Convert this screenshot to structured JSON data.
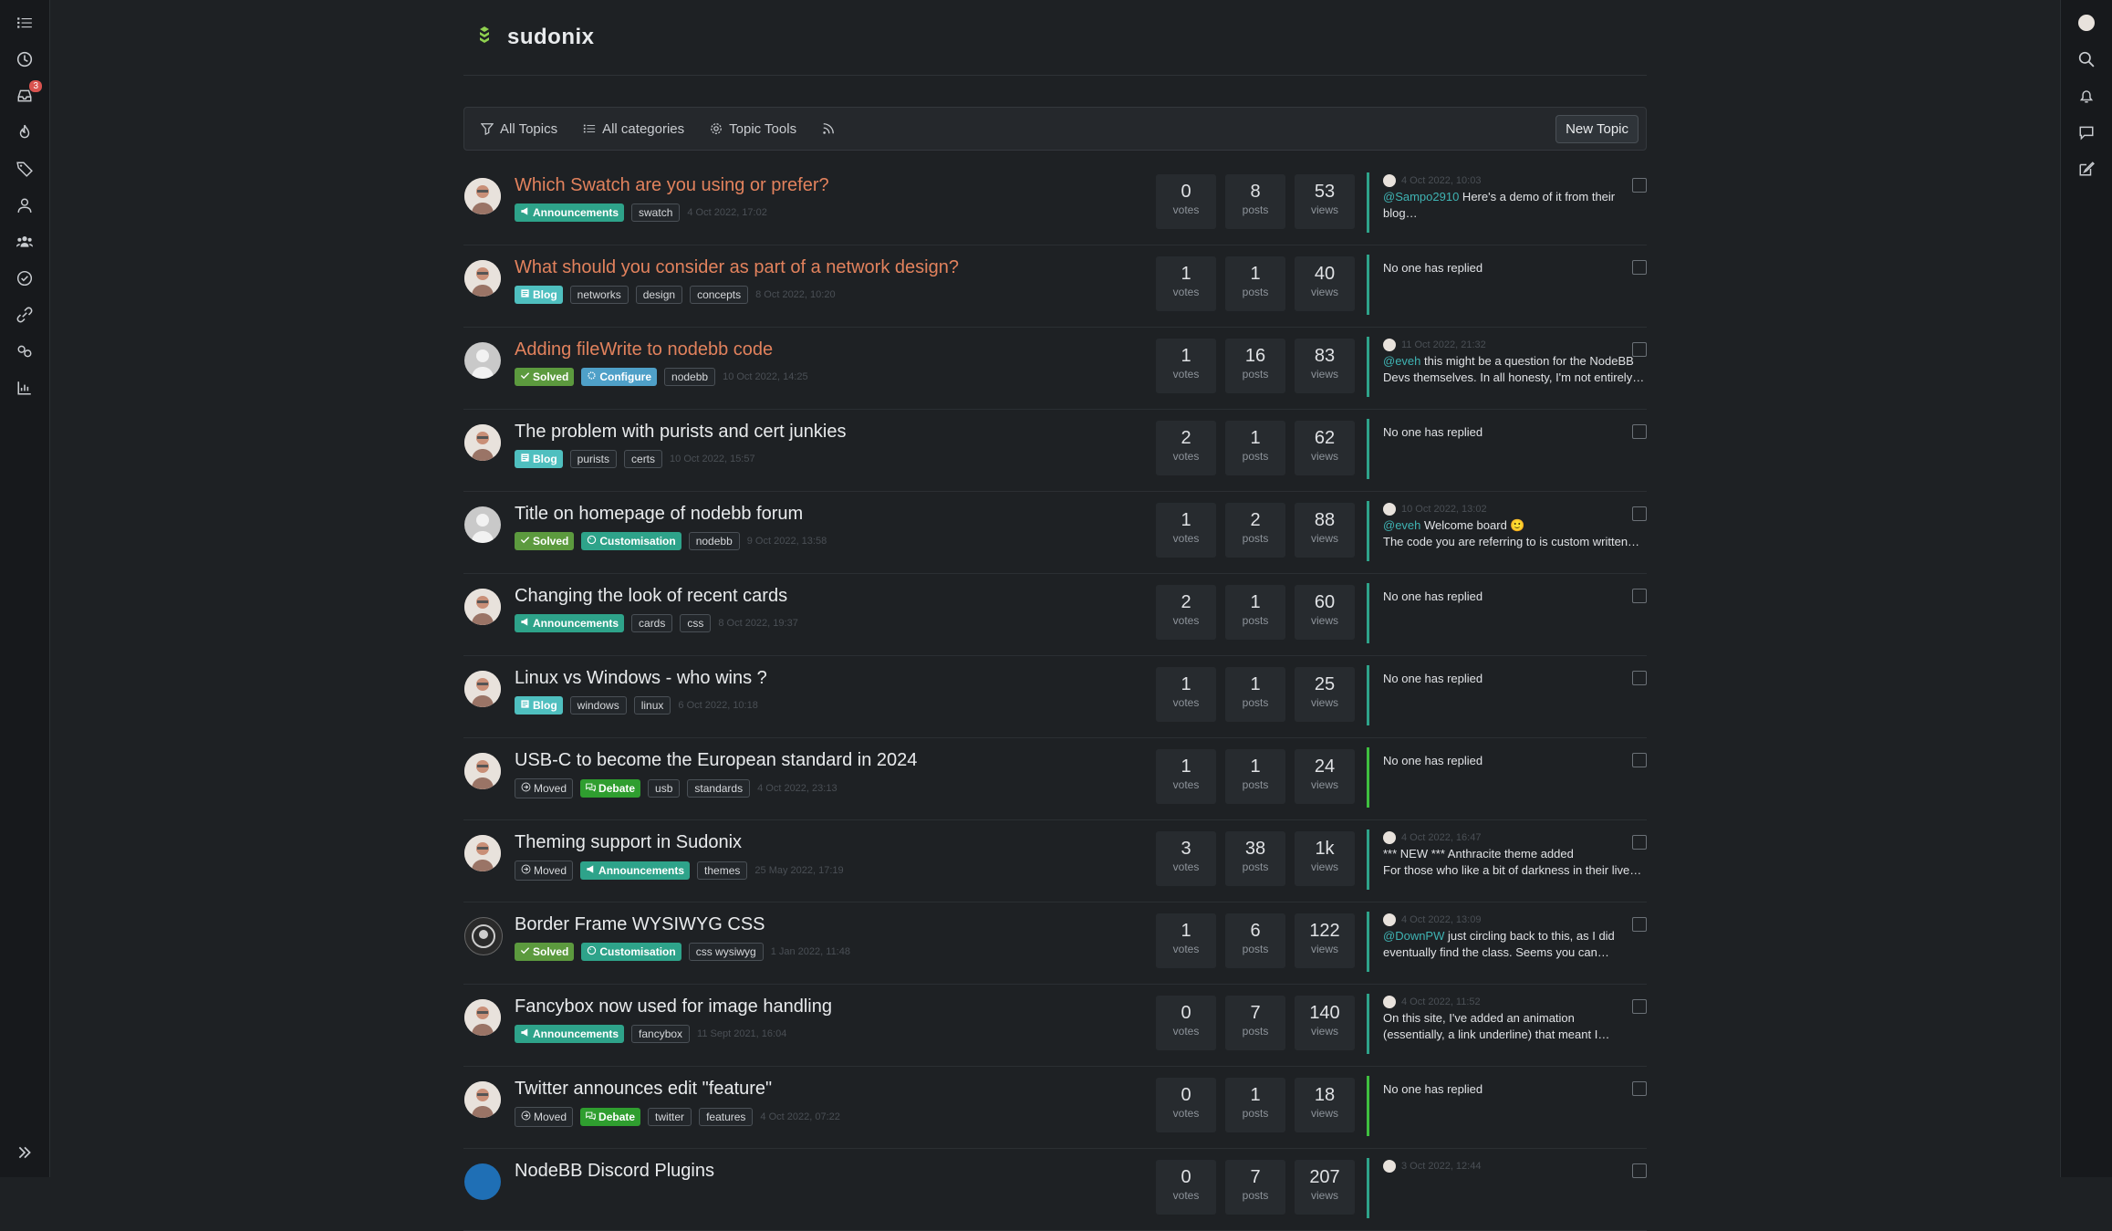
{
  "brand": {
    "name": "sudonix"
  },
  "nav": {
    "inbox_badge": "3"
  },
  "toolbar": {
    "all_topics": "All Topics",
    "all_categories": "All categories",
    "topic_tools": "Topic Tools",
    "new_topic": "New Topic"
  },
  "labels": {
    "votes": "votes",
    "posts": "posts",
    "views": "views"
  },
  "colors": {
    "announcements": "#2ea38a",
    "blog": "#4fbfbf",
    "solved": "#5c9a3e",
    "configure": "#4fa0c8",
    "customisation": "#2ea38a",
    "debate": "#2f9e2f",
    "moved": "#23272b",
    "hot_title": "#e2825d"
  },
  "topics": [
    {
      "title": "Which Swatch are you using or prefer?",
      "hot": true,
      "avatar": "user",
      "pills": [
        {
          "text": "Announcements",
          "kind": "announcements",
          "icon": "megaphone-icon"
        }
      ],
      "tags": [
        "swatch"
      ],
      "time": "4 Oct 2022, 17:02",
      "votes": "0",
      "posts": "8",
      "views": "53",
      "last": {
        "time": "4 Oct 2022, 10:03",
        "mention": "@Sampo2910",
        "line1": " Here's a demo of it from their",
        "line2": "blog…"
      },
      "bar": "teal"
    },
    {
      "title": "What should you consider as part of a network design?",
      "hot": true,
      "avatar": "user",
      "pills": [
        {
          "text": "Blog",
          "kind": "blog",
          "icon": "blog-icon"
        }
      ],
      "tags": [
        "networks",
        "design",
        "concepts"
      ],
      "time": "8 Oct 2022, 10:20",
      "votes": "1",
      "posts": "1",
      "views": "40",
      "noreply": "No one has replied",
      "bar": "teal"
    },
    {
      "title": "Adding fileWrite to nodebb code",
      "hot": true,
      "avatar": "grey",
      "pills": [
        {
          "text": "Solved",
          "kind": "solved",
          "icon": "check-icon"
        },
        {
          "text": "Configure",
          "kind": "configure",
          "icon": "cog-icon"
        }
      ],
      "tags": [
        "nodebb"
      ],
      "time": "10 Oct 2022, 14:25",
      "votes": "1",
      "posts": "16",
      "views": "83",
      "last": {
        "time": "11 Oct 2022, 21:32",
        "mention": "@eveh",
        "line1": " this might be a question for the NodeBB",
        "line2": "Devs themselves. In all honesty, I'm not entirely…"
      },
      "bar": "teal"
    },
    {
      "title": "The problem with purists and cert junkies",
      "hot": false,
      "avatar": "user",
      "pills": [
        {
          "text": "Blog",
          "kind": "blog",
          "icon": "blog-icon"
        }
      ],
      "tags": [
        "purists",
        "certs"
      ],
      "time": "10 Oct 2022, 15:57",
      "votes": "2",
      "posts": "1",
      "views": "62",
      "noreply": "No one has replied",
      "bar": "teal"
    },
    {
      "title": "Title on homepage of nodebb forum",
      "hot": false,
      "avatar": "grey",
      "pills": [
        {
          "text": "Solved",
          "kind": "solved",
          "icon": "check-icon"
        },
        {
          "text": "Customisation",
          "kind": "customisation",
          "icon": "brush-icon"
        }
      ],
      "tags": [
        "nodebb"
      ],
      "time": "9 Oct 2022, 13:58",
      "votes": "1",
      "posts": "2",
      "views": "88",
      "last": {
        "time": "10 Oct 2022, 13:02",
        "mention": "@eveh",
        "line1": " Welcome board 🙂",
        "line2": "The code you are referring to is custom written…"
      },
      "bar": "teal"
    },
    {
      "title": "Changing the look of recent cards",
      "hot": false,
      "avatar": "user",
      "pills": [
        {
          "text": "Announcements",
          "kind": "announcements",
          "icon": "megaphone-icon"
        }
      ],
      "tags": [
        "cards",
        "css"
      ],
      "time": "8 Oct 2022, 19:37",
      "votes": "2",
      "posts": "1",
      "views": "60",
      "noreply": "No one has replied",
      "bar": "teal"
    },
    {
      "title": "Linux vs Windows - who wins ?",
      "hot": false,
      "avatar": "user",
      "pills": [
        {
          "text": "Blog",
          "kind": "blog",
          "icon": "blog-icon"
        }
      ],
      "tags": [
        "windows",
        "linux"
      ],
      "time": "6 Oct 2022, 10:18",
      "votes": "1",
      "posts": "1",
      "views": "25",
      "noreply": "No one has replied",
      "bar": "teal"
    },
    {
      "title": "USB-C to become the European standard in 2024",
      "hot": false,
      "avatar": "user",
      "pills": [
        {
          "text": "Moved",
          "kind": "moved",
          "icon": "moved-icon"
        },
        {
          "text": "Debate",
          "kind": "debate",
          "icon": "comments-icon"
        }
      ],
      "tags": [
        "usb",
        "standards"
      ],
      "time": "4 Oct 2022, 23:13",
      "votes": "1",
      "posts": "1",
      "views": "24",
      "noreply": "No one has replied",
      "bar": "green"
    },
    {
      "title": "Theming support in Sudonix",
      "hot": false,
      "avatar": "user",
      "pills": [
        {
          "text": "Moved",
          "kind": "moved",
          "icon": "moved-icon"
        },
        {
          "text": "Announcements",
          "kind": "announcements",
          "icon": "megaphone-icon"
        }
      ],
      "tags": [
        "themes"
      ],
      "time": "25 May 2022, 17:19",
      "votes": "3",
      "posts": "38",
      "views": "1k",
      "last": {
        "time": "4 Oct 2022, 16:47",
        "mention": "",
        "line1": "*** NEW *** Anthracite theme added",
        "line2": "For those who like a bit of darkness in their live…"
      },
      "bar": "teal"
    },
    {
      "title": "Border Frame WYSIWYG CSS",
      "hot": false,
      "avatar": "dark",
      "pills": [
        {
          "text": "Solved",
          "kind": "solved",
          "icon": "check-icon"
        },
        {
          "text": "Customisation",
          "kind": "customisation",
          "icon": "brush-icon"
        }
      ],
      "tags": [
        "css wysiwyg"
      ],
      "time": "1 Jan 2022, 11:48",
      "votes": "1",
      "posts": "6",
      "views": "122",
      "last": {
        "time": "4 Oct 2022, 13:09",
        "mention": "@DownPW",
        "line1": " just circling back to this, as I did",
        "line2": "eventually find the class. Seems you can…"
      },
      "bar": "teal"
    },
    {
      "title": "Fancybox now used for image handling",
      "hot": false,
      "avatar": "user",
      "pills": [
        {
          "text": "Announcements",
          "kind": "announcements",
          "icon": "megaphone-icon"
        }
      ],
      "tags": [
        "fancybox"
      ],
      "time": "11 Sept 2021, 16:04",
      "votes": "0",
      "posts": "7",
      "views": "140",
      "last": {
        "time": "4 Oct 2022, 11:52",
        "mention": "",
        "line1": "On this site, I've added an animation",
        "line2": "(essentially, a link underline) that meant I…"
      },
      "bar": "teal"
    },
    {
      "title": "Twitter announces edit \"feature\"",
      "hot": false,
      "avatar": "user",
      "pills": [
        {
          "text": "Moved",
          "kind": "moved",
          "icon": "moved-icon"
        },
        {
          "text": "Debate",
          "kind": "debate",
          "icon": "comments-icon"
        }
      ],
      "tags": [
        "twitter",
        "features"
      ],
      "time": "4 Oct 2022, 07:22",
      "votes": "0",
      "posts": "1",
      "views": "18",
      "noreply": "No one has replied",
      "bar": "green"
    },
    {
      "title": "NodeBB Discord Plugins",
      "hot": false,
      "avatar": "blue",
      "pills": [],
      "tags": [],
      "time": "",
      "votes": "0",
      "posts": "7",
      "views": "207",
      "last": {
        "time": "3 Oct 2022, 12:44",
        "mention": "",
        "line1": "",
        "line2": ""
      },
      "bar": "teal"
    }
  ]
}
